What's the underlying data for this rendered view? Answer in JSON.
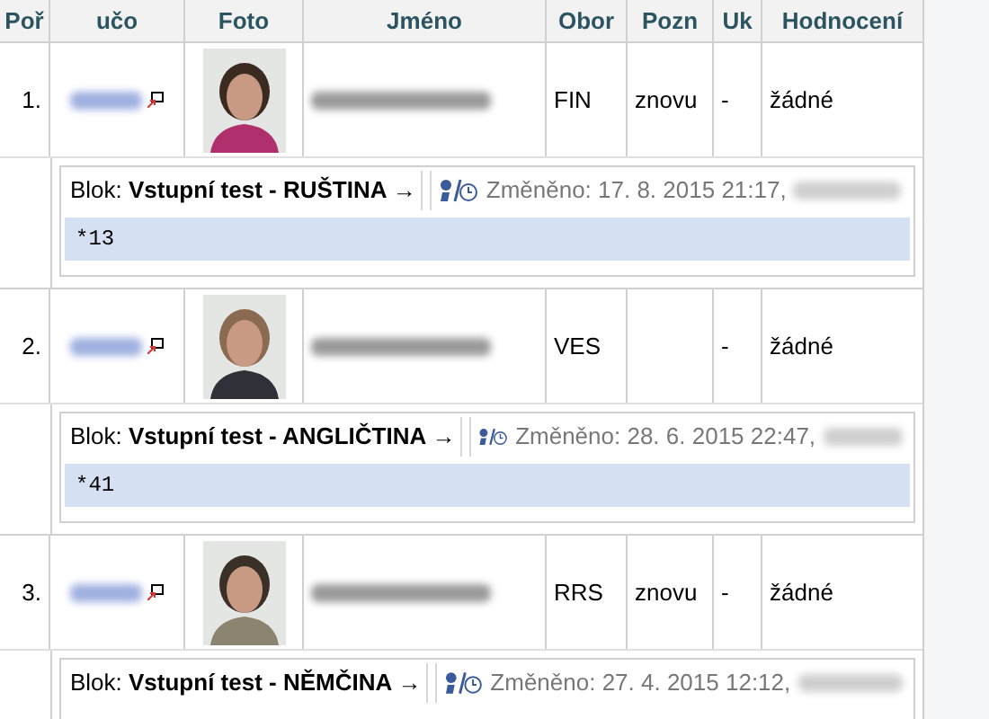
{
  "table": {
    "columns": [
      "Poř",
      "učo",
      "Foto",
      "Jméno",
      "Obor",
      "Pozn",
      "Uk",
      "Hodnocení"
    ],
    "rows": [
      {
        "index": "1.",
        "obor": "FIN",
        "pozn": "znovu",
        "uk": "-",
        "hodnoceni": "žádné",
        "block": {
          "title": "Blok: **Vstupní test - RUŠTINA →**",
          "changed": "Změněno: 17. 8. 2015 21:17,",
          "note": "*13"
        }
      },
      {
        "index": "2.",
        "obor": "VES",
        "uk": "-",
        "hodnoceni": "žádné",
        "block": {
          "title": "Blok: **Vstupní test - ANGLIČTINA →**",
          "changed": "Změněno: 28. 6. 2015 22:47,",
          "note": "*41"
        }
      },
      {
        "index": "3.",
        "obor": "RRS",
        "pozn": "znovu",
        "uk": "-",
        "hodnoceni": "žádné",
        "block": {
          "title": "Blok: **Vstupní test - NĚMČINA →**",
          "changed": "Změněno: 27. 4. 2015 12:12,"
        }
      }
    ]
  }
}
